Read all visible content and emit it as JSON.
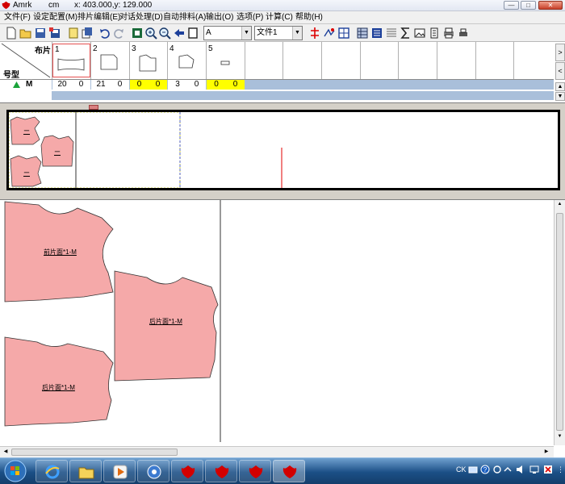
{
  "titlebar": {
    "app_name": "Amrk",
    "unit": "cm",
    "coords": "x: 403.000,y: 129.000",
    "minimize_glyph": "—",
    "maximize_glyph": "□",
    "close_glyph": "✕"
  },
  "menu": {
    "items": [
      "文件(F)",
      "设定配置(M)",
      "排片编辑(E)",
      "对话处理(D)",
      "自动排料(A)",
      "输出(O)",
      "选项(P)",
      "计算(C)",
      "帮助(H)"
    ]
  },
  "toolbar": {
    "combo_a": "A",
    "combo_file": "文件1",
    "icons": [
      "new-file-icon",
      "open-folder-icon",
      "save-icon",
      "save-as-icon",
      "layer-icon",
      "copy-icon",
      "undo-icon",
      "redo-icon",
      "zoom-fit-icon",
      "zoom-in-icon",
      "zoom-out-icon",
      "back-arrow-icon",
      "window-icon",
      "split-icon",
      "cut-piece-icon",
      "grid-icon",
      "table-icon",
      "list-icon",
      "sum-icon",
      "image-icon",
      "page-icon",
      "print-icon",
      "printer-setup-icon"
    ]
  },
  "grid": {
    "header_piece": "布片",
    "header_size": "号型",
    "size_name": "M",
    "pieces": [
      {
        "num": "1",
        "qty_a": "20",
        "qty_b": "0",
        "highlight": false
      },
      {
        "num": "2",
        "qty_a": "21",
        "qty_b": "0",
        "highlight": false
      },
      {
        "num": "3",
        "qty_a": "0",
        "qty_b": "0",
        "highlight": true
      },
      {
        "num": "4",
        "qty_a": "3",
        "qty_b": "0",
        "highlight": false
      },
      {
        "num": "5",
        "qty_a": "0",
        "qty_b": "0",
        "highlight": true
      }
    ],
    "scroll_right": ">",
    "scroll_left": "<",
    "scroll_up": "▲",
    "scroll_down": "▼"
  },
  "overview": {
    "mini_label": "ー"
  },
  "main": {
    "piece_labels": [
      "前片面*1-M",
      "后片面*1-M",
      "后片面*1-M"
    ]
  },
  "taskbar": {
    "lang": "CK",
    "clock_glyph": "⋮"
  },
  "colors": {
    "piece_fill": "#f5a9a9",
    "grid_blue": "#a9bfda",
    "highlight": "#ffff00",
    "accent_red": "#e00000"
  }
}
